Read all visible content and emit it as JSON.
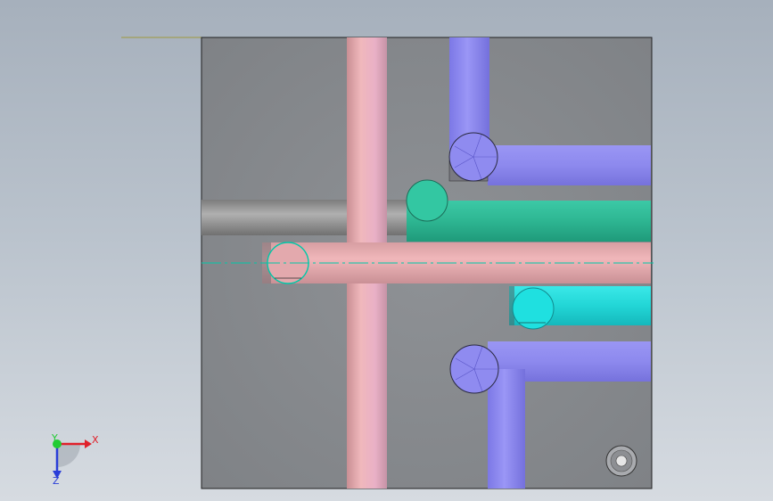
{
  "viewport": {
    "background_top": "#a6b0bc",
    "background_bottom": "#d6dbe1"
  },
  "part": {
    "face_color": "#8a8d91",
    "edge_color": "#222222"
  },
  "pipes": {
    "pink_color": "#e8aeb2",
    "blue_color": "#8c88ee",
    "green_color": "#2fb894",
    "cyan_color": "#25dcdc",
    "grey_color": "#909090",
    "centerline_color": "#00c8a8"
  },
  "triad": {
    "x_label": "X",
    "y_label": "Y",
    "z_label": "Z",
    "x_color": "#e0202a",
    "y_color": "#22cc33",
    "z_color": "#2a3ed8"
  }
}
